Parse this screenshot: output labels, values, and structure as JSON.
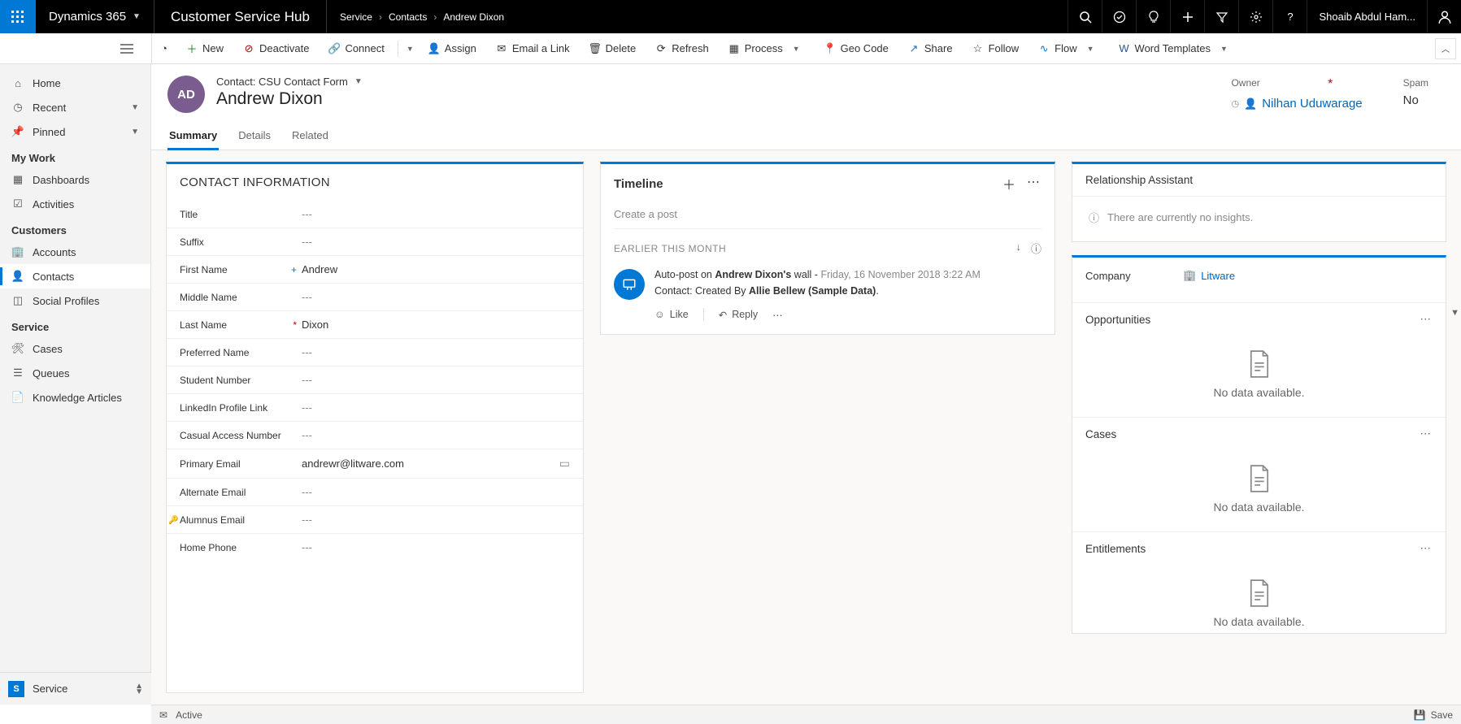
{
  "topbar": {
    "brand": "Dynamics 365",
    "hub": "Customer Service Hub",
    "breadcrumbs": [
      "Service",
      "Contacts",
      "Andrew Dixon"
    ],
    "user": "Shoaib Abdul Ham..."
  },
  "commands": {
    "new": "New",
    "deactivate": "Deactivate",
    "connect": "Connect",
    "assign": "Assign",
    "email_link": "Email a Link",
    "delete": "Delete",
    "refresh": "Refresh",
    "process": "Process",
    "geocode": "Geo Code",
    "share": "Share",
    "follow": "Follow",
    "flow": "Flow",
    "word_templates": "Word Templates"
  },
  "sidebar": {
    "home": "Home",
    "recent": "Recent",
    "pinned": "Pinned",
    "group_mywork": "My Work",
    "dashboards": "Dashboards",
    "activities": "Activities",
    "group_customers": "Customers",
    "accounts": "Accounts",
    "contacts": "Contacts",
    "social_profiles": "Social Profiles",
    "group_service": "Service",
    "cases": "Cases",
    "queues": "Queues",
    "knowledge": "Knowledge Articles",
    "area_letter": "S",
    "area_label": "Service"
  },
  "record": {
    "form_label": "Contact: CSU Contact Form",
    "avatar_initials": "AD",
    "name": "Andrew Dixon",
    "owner_label": "Owner",
    "owner_value": "Nilhan Uduwarage",
    "spam_label": "Spam",
    "spam_value": "No"
  },
  "tabs": {
    "summary": "Summary",
    "details": "Details",
    "related": "Related"
  },
  "contact_info": {
    "title": "CONTACT INFORMATION",
    "fields": {
      "title": {
        "label": "Title",
        "value": "---"
      },
      "suffix": {
        "label": "Suffix",
        "value": "---"
      },
      "first_name": {
        "label": "First Name",
        "value": "Andrew"
      },
      "middle_name": {
        "label": "Middle Name",
        "value": "---"
      },
      "last_name": {
        "label": "Last Name",
        "value": "Dixon"
      },
      "preferred_name": {
        "label": "Preferred Name",
        "value": "---"
      },
      "student_number": {
        "label": "Student Number",
        "value": "---"
      },
      "linkedin": {
        "label": "LinkedIn Profile Link",
        "value": "---"
      },
      "casual_access": {
        "label": "Casual Access Number",
        "value": "---"
      },
      "primary_email": {
        "label": "Primary Email",
        "value": "andrewr@litware.com"
      },
      "alternate_email": {
        "label": "Alternate Email",
        "value": "---"
      },
      "alumnus_email": {
        "label": "Alumnus Email",
        "value": "---"
      },
      "home_phone": {
        "label": "Home Phone",
        "value": "---"
      }
    }
  },
  "timeline": {
    "title": "Timeline",
    "create_post": "Create a post",
    "subhead": "EARLIER THIS MONTH",
    "post": {
      "prefix": "Auto-post on ",
      "target": "Andrew Dixon's",
      "suffix": " wall - ",
      "date": "Friday, 16 November 2018 3:22 AM",
      "line2_prefix": "Contact: Created By ",
      "line2_bold": "Allie Bellew (Sample Data)",
      "line2_suffix": "."
    },
    "actions": {
      "like": "Like",
      "reply": "Reply"
    }
  },
  "ra": {
    "title": "Relationship Assistant",
    "empty": "There are currently no insights."
  },
  "company": {
    "label": "Company",
    "value": "Litware"
  },
  "opportunities": {
    "title": "Opportunities",
    "empty": "No data available."
  },
  "cases": {
    "title": "Cases",
    "empty": "No data available."
  },
  "entitlements": {
    "title": "Entitlements",
    "empty": "No data available."
  },
  "status": {
    "state": "Active",
    "save": "Save"
  }
}
